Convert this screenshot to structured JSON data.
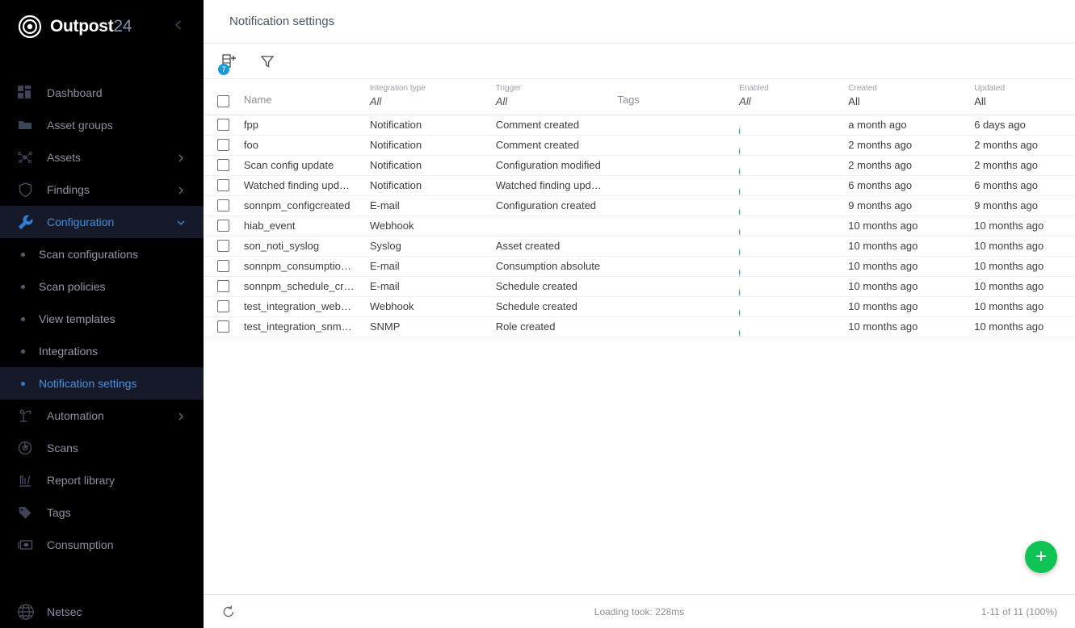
{
  "brand": {
    "name": "Outpost",
    "number": "24",
    "logo_icon": "target-logo-icon",
    "collapse_icon": "chevron-left-icon"
  },
  "sidebar": {
    "items": [
      {
        "label": "Dashboard",
        "icon": "dashboard-grid-icon",
        "chevron": false,
        "active": false
      },
      {
        "label": "Asset groups",
        "icon": "folder-icon",
        "chevron": false,
        "active": false
      },
      {
        "label": "Assets",
        "icon": "network-nodes-icon",
        "chevron": true,
        "active": false
      },
      {
        "label": "Findings",
        "icon": "shield-icon",
        "chevron": true,
        "active": false
      },
      {
        "label": "Configuration",
        "icon": "wrench-icon",
        "chevron": true,
        "active": true
      }
    ],
    "sub_items": [
      {
        "label": "Scan configurations",
        "active": false
      },
      {
        "label": "Scan policies",
        "active": false
      },
      {
        "label": "View templates",
        "active": false
      },
      {
        "label": "Integrations",
        "active": false
      },
      {
        "label": "Notification settings",
        "active": true
      }
    ],
    "items_after": [
      {
        "label": "Automation",
        "icon": "automation-robot-icon",
        "chevron": true,
        "active": false
      },
      {
        "label": "Scans",
        "icon": "scan-radar-icon",
        "chevron": false,
        "active": false
      },
      {
        "label": "Report library",
        "icon": "report-chart-icon",
        "chevron": false,
        "active": false
      },
      {
        "label": "Tags",
        "icon": "tag-icon",
        "chevron": false,
        "active": false
      },
      {
        "label": "Consumption",
        "icon": "banknote-icon",
        "chevron": false,
        "active": false
      }
    ],
    "footer_item": {
      "label": "Netsec",
      "icon": "globe-icon"
    }
  },
  "header": {
    "title": "Notification settings"
  },
  "toolbar": {
    "columns_button": {
      "icon": "column-add-icon",
      "badge": "7"
    },
    "filter_button": {
      "icon": "funnel-filter-icon"
    }
  },
  "table": {
    "columns": [
      {
        "key": "checkbox",
        "sub": "",
        "label": "",
        "style": ""
      },
      {
        "key": "name",
        "sub": "",
        "label": "Name",
        "style": "label"
      },
      {
        "key": "integration_type",
        "sub": "Integration type",
        "label": "All",
        "style": "italic"
      },
      {
        "key": "trigger",
        "sub": "Trigger",
        "label": "All",
        "style": "italic"
      },
      {
        "key": "tags",
        "sub": "",
        "label": "Tags",
        "style": "label"
      },
      {
        "key": "enabled",
        "sub": "Enabled",
        "label": "All",
        "style": "italic"
      },
      {
        "key": "created",
        "sub": "Created",
        "label": "All",
        "style": "plain"
      },
      {
        "key": "updated",
        "sub": "Updated",
        "label": "All",
        "style": "plain"
      }
    ],
    "rows": [
      {
        "name": "fpp",
        "integration_type": "Notification",
        "trigger": "Comment created",
        "tags": "",
        "enabled": true,
        "created": "a month ago",
        "updated": "6 days ago"
      },
      {
        "name": "foo",
        "integration_type": "Notification",
        "trigger": "Comment created",
        "tags": "",
        "enabled": true,
        "created": "2 months ago",
        "updated": "2 months ago"
      },
      {
        "name": "Scan config update",
        "integration_type": "Notification",
        "trigger": "Configuration modified",
        "tags": "",
        "enabled": true,
        "created": "2 months ago",
        "updated": "2 months ago"
      },
      {
        "name": "Watched finding upd…",
        "integration_type": "Notification",
        "trigger": "Watched finding upd…",
        "tags": "",
        "enabled": true,
        "created": "6 months ago",
        "updated": "6 months ago"
      },
      {
        "name": "sonnpm_configcreated",
        "integration_type": "E-mail",
        "trigger": "Configuration created",
        "tags": "",
        "enabled": true,
        "created": "9 months ago",
        "updated": "9 months ago"
      },
      {
        "name": "hiab_event",
        "integration_type": "Webhook",
        "trigger": "",
        "tags": "",
        "enabled": true,
        "created": "10 months ago",
        "updated": "10 months ago"
      },
      {
        "name": "son_noti_syslog",
        "integration_type": "Syslog",
        "trigger": "Asset created",
        "tags": "",
        "enabled": true,
        "created": "10 months ago",
        "updated": "10 months ago"
      },
      {
        "name": "sonnpm_consumptio…",
        "integration_type": "E-mail",
        "trigger": "Consumption absolute",
        "tags": "",
        "enabled": true,
        "created": "10 months ago",
        "updated": "10 months ago"
      },
      {
        "name": "sonnpm_schedule_cr…",
        "integration_type": "E-mail",
        "trigger": "Schedule created",
        "tags": "",
        "enabled": true,
        "created": "10 months ago",
        "updated": "10 months ago"
      },
      {
        "name": "test_integration_web…",
        "integration_type": "Webhook",
        "trigger": "Schedule created",
        "tags": "",
        "enabled": true,
        "created": "10 months ago",
        "updated": "10 months ago"
      },
      {
        "name": "test_integration_snm…",
        "integration_type": "SNMP",
        "trigger": "Role created",
        "tags": "",
        "enabled": true,
        "created": "10 months ago",
        "updated": "10 months ago"
      }
    ]
  },
  "fab": {
    "label": "+",
    "icon": "plus-icon",
    "color": "#10c355"
  },
  "footer": {
    "refresh_icon": "refresh-icon",
    "loading_text": "Loading took: 228ms",
    "pagination_text": "1-11 of 11 (100%)"
  },
  "colors": {
    "sidebar_bg": "#000000",
    "sidebar_active_bg": "#16192a",
    "accent_blue": "#2f7fd1",
    "toggle_on": "#0c9ae3",
    "badge_blue": "#1a9bdc",
    "fab_green": "#10c355"
  }
}
